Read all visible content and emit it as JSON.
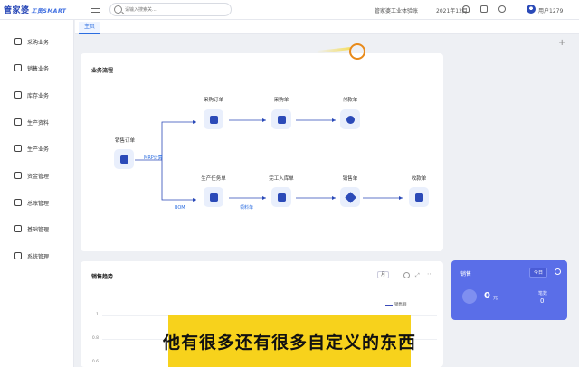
{
  "header": {
    "logo_text": "管家婆",
    "logo_sub": "工贸SMART",
    "search_placeholder": "请输入搜索关...",
    "company": "管家婆工业体验账",
    "period": "2021年12月",
    "user": "用户1279"
  },
  "sidebar": {
    "items": [
      {
        "label": "采购业务",
        "icon": "cart-icon"
      },
      {
        "label": "销售业务",
        "icon": "bar-chart-icon"
      },
      {
        "label": "库存业务",
        "icon": "warehouse-icon"
      },
      {
        "label": "生产资料",
        "icon": "document-icon"
      },
      {
        "label": "生产业务",
        "icon": "sliders-icon"
      },
      {
        "label": "资金管理",
        "icon": "money-icon"
      },
      {
        "label": "总账管理",
        "icon": "ledger-icon"
      },
      {
        "label": "基础管理",
        "icon": "gear-icon"
      },
      {
        "label": "系统管理",
        "icon": "settings-icon"
      }
    ]
  },
  "tabs": [
    {
      "label": "主页"
    }
  ],
  "process": {
    "title": "业务流程",
    "nodes": {
      "sales_order": "销售订单",
      "purchase_order": "采购订单",
      "purchase_bill": "采购单",
      "payment": "付款单",
      "production_task": "生产任务单",
      "finished_stock_in": "完工入库单",
      "sales_bill": "销售单",
      "receipt": "收款单"
    },
    "mrp": "MRP计算",
    "bom": "BOM",
    "material_issue": "领料单"
  },
  "sales_trend": {
    "title": "销售趋势",
    "selector": "月",
    "legend": "销售额",
    "ticks": [
      "1",
      "0.8",
      "0.6"
    ]
  },
  "sales_card": {
    "title": "销售",
    "period": "今日",
    "amount": "0",
    "unit": "元",
    "sub_label": "笔数",
    "sub_value": "0"
  },
  "caption": "他有很多还有很多自定义的东西"
}
